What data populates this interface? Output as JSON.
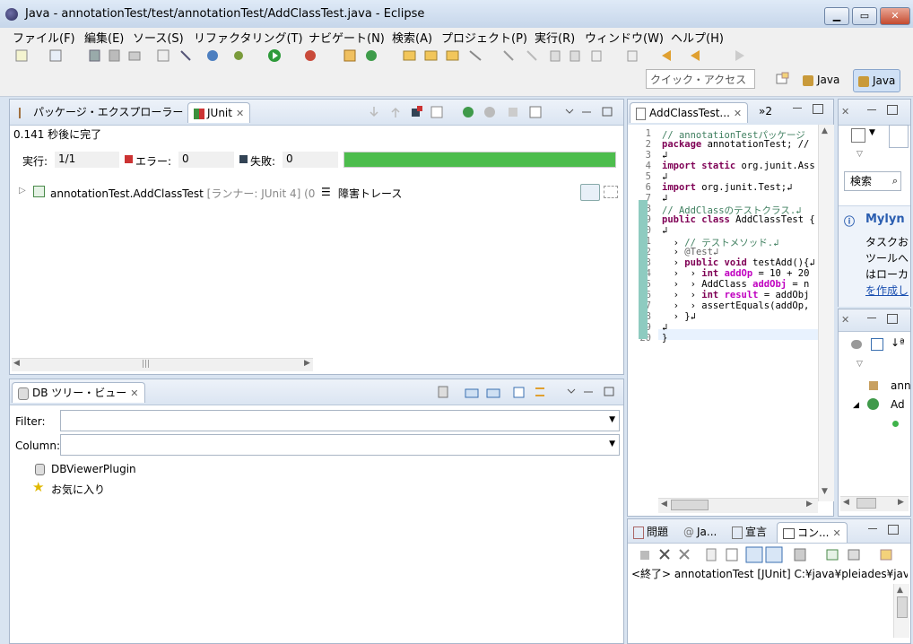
{
  "window": {
    "title": "Java - annotationTest/test/annotationTest/AddClassTest.java - Eclipse",
    "controls": {
      "minimize": "▁",
      "maximize": "▭",
      "close": "✕"
    }
  },
  "menu": [
    "ファイル(F)",
    "編集(E)",
    "ソース(S)",
    "リファクタリング(T)",
    "ナビゲート(N)",
    "検索(A)",
    "プロジェクト(P)",
    "実行(R)",
    "ウィンドウ(W)",
    "ヘルプ(H)"
  ],
  "toolbar": {
    "quick_access_placeholder": "クイック・アクセス",
    "perspectives": [
      "Java",
      "Java"
    ]
  },
  "left_top": {
    "tabs": [
      "パッケージ・エクスプローラー",
      "JUnit"
    ],
    "status": "0.141 秒後に完了",
    "runs_label": "実行:",
    "runs_value": "1/1",
    "errors_label": "エラー:",
    "errors_value": "0",
    "failures_label": "失敗:",
    "failures_value": "0",
    "progress": 1.0,
    "progress_color": "#4dbd4d",
    "tree_item": "annotationTest.AddClassTest",
    "tree_item_suffix": "[ランナー: JUnit 4] (0",
    "trace_label": "障害トレース"
  },
  "left_bottom": {
    "tab": "DB ツリー・ビュー",
    "filter_label": "Filter:",
    "column_label": "Column:",
    "items": [
      "DBViewerPlugin",
      "お気に入り"
    ]
  },
  "editor": {
    "tab": "AddClassTest...",
    "overflow": "»2",
    "line_numbers": [
      "1",
      "2",
      "3",
      "4",
      "5",
      "6",
      "7",
      "8",
      "9",
      "10",
      "11",
      "12",
      "13",
      "14",
      "15",
      "16",
      "17",
      "18",
      "19",
      "20"
    ],
    "lines": [
      [
        [
          "cm",
          "// annotationTestパッケージ"
        ]
      ],
      [
        [
          "kw",
          "package"
        ],
        [
          "t",
          " annotationTest; //"
        ]
      ],
      [
        [
          "t",
          "↲"
        ]
      ],
      [
        [
          "kw",
          "import static"
        ],
        [
          "t",
          " org.junit.Ass"
        ]
      ],
      [
        [
          "t",
          "↲"
        ]
      ],
      [
        [
          "kw",
          "import"
        ],
        [
          "t",
          " org.junit.Test;↲"
        ]
      ],
      [
        [
          "t",
          "↲"
        ]
      ],
      [
        [
          "cm",
          "// AddClassのテストクラス.↲"
        ]
      ],
      [
        [
          "kw",
          "public class"
        ],
        [
          "t",
          " AddClassTest {"
        ]
      ],
      [
        [
          "t",
          "↲"
        ]
      ],
      [
        [
          "t",
          "  › "
        ],
        [
          "cm",
          "// テストメソッド.↲"
        ]
      ],
      [
        [
          "t",
          "  › "
        ],
        [
          "an",
          "@Test↲"
        ]
      ],
      [
        [
          "t",
          "  › "
        ],
        [
          "kw",
          "public void"
        ],
        [
          "t",
          " testAdd(){↲"
        ]
      ],
      [
        [
          "t",
          "  ›  › "
        ],
        [
          "kw",
          "int"
        ],
        [
          "t",
          " "
        ],
        [
          "vr",
          "addOp"
        ],
        [
          "t",
          " = 10 + 20"
        ]
      ],
      [
        [
          "t",
          "  ›  › AddClass "
        ],
        [
          "vr",
          "addObj"
        ],
        [
          "t",
          " = n"
        ]
      ],
      [
        [
          "t",
          "  ›  › "
        ],
        [
          "kw",
          "int"
        ],
        [
          "t",
          " "
        ],
        [
          "vr",
          "result"
        ],
        [
          "t",
          " = addObj"
        ]
      ],
      [
        [
          "t",
          "  ›  › "
        ],
        [
          "t",
          "assertEquals(addOp,"
        ]
      ],
      [
        [
          "t",
          "  › }↲"
        ]
      ],
      [
        [
          "t",
          "↲"
        ]
      ],
      [
        [
          "t",
          "}"
        ]
      ]
    ]
  },
  "outline": {
    "search_label": "検索",
    "mylyn_title": "Mylyn",
    "mylyn_lines": [
      "タスクお",
      "ツールへ",
      "はローカ",
      "を作成し"
    ],
    "tree_items": [
      "ann",
      "Ad"
    ]
  },
  "console": {
    "tabs": [
      "問題",
      "Ja...",
      "宣言",
      "コン..."
    ],
    "line": "<終了> annotationTest [JUnit] C:¥java¥pleiades¥java"
  }
}
